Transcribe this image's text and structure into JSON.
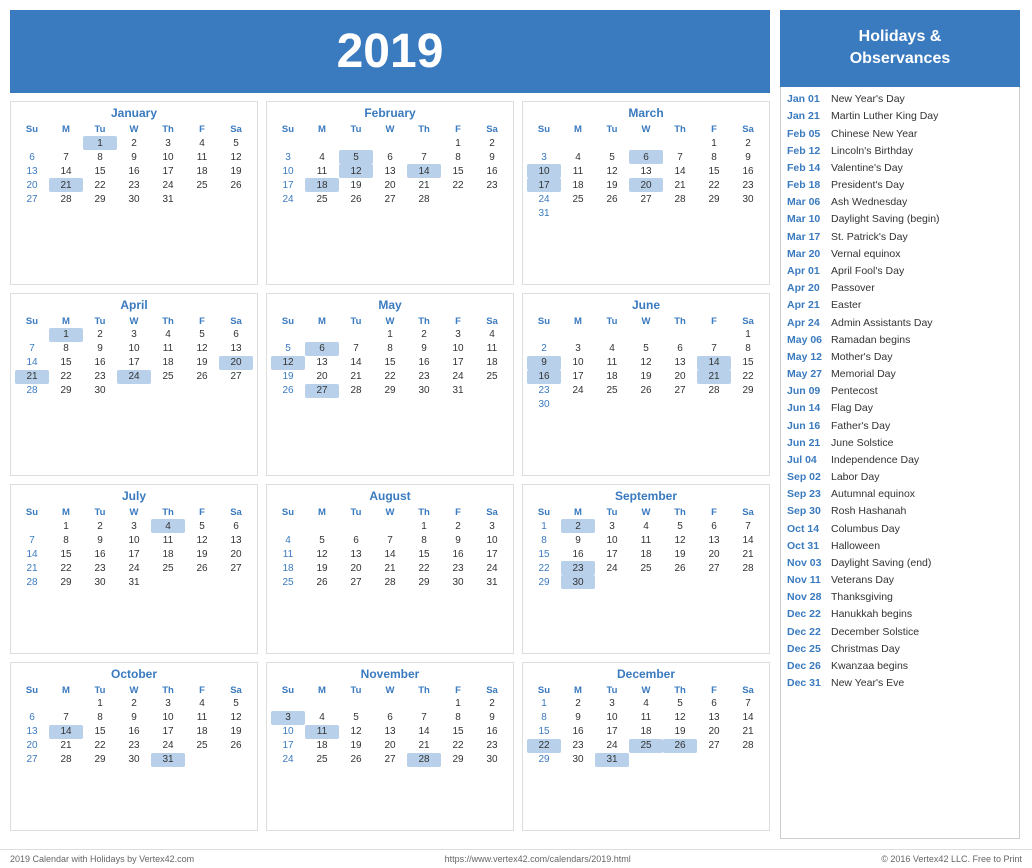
{
  "header": {
    "year": "2019"
  },
  "holidays_header": "Holidays &\nObservances",
  "holidays": [
    {
      "date": "Jan 01",
      "name": "New Year's Day"
    },
    {
      "date": "Jan 21",
      "name": "Martin Luther King Day"
    },
    {
      "date": "Feb 05",
      "name": "Chinese New Year"
    },
    {
      "date": "Feb 12",
      "name": "Lincoln's Birthday"
    },
    {
      "date": "Feb 14",
      "name": "Valentine's Day"
    },
    {
      "date": "Feb 18",
      "name": "President's Day"
    },
    {
      "date": "Mar 06",
      "name": "Ash Wednesday"
    },
    {
      "date": "Mar 10",
      "name": "Daylight Saving (begin)"
    },
    {
      "date": "Mar 17",
      "name": "St. Patrick's Day"
    },
    {
      "date": "Mar 20",
      "name": "Vernal equinox"
    },
    {
      "date": "Apr 01",
      "name": "April Fool's Day"
    },
    {
      "date": "Apr 20",
      "name": "Passover"
    },
    {
      "date": "Apr 21",
      "name": "Easter"
    },
    {
      "date": "Apr 24",
      "name": "Admin Assistants Day"
    },
    {
      "date": "May 06",
      "name": "Ramadan begins"
    },
    {
      "date": "May 12",
      "name": "Mother's Day"
    },
    {
      "date": "May 27",
      "name": "Memorial Day"
    },
    {
      "date": "Jun 09",
      "name": "Pentecost"
    },
    {
      "date": "Jun 14",
      "name": "Flag Day"
    },
    {
      "date": "Jun 16",
      "name": "Father's Day"
    },
    {
      "date": "Jun 21",
      "name": "June Solstice"
    },
    {
      "date": "Jul 04",
      "name": "Independence Day"
    },
    {
      "date": "Sep 02",
      "name": "Labor Day"
    },
    {
      "date": "Sep 23",
      "name": "Autumnal equinox"
    },
    {
      "date": "Sep 30",
      "name": "Rosh Hashanah"
    },
    {
      "date": "Oct 14",
      "name": "Columbus Day"
    },
    {
      "date": "Oct 31",
      "name": "Halloween"
    },
    {
      "date": "Nov 03",
      "name": "Daylight Saving (end)"
    },
    {
      "date": "Nov 11",
      "name": "Veterans Day"
    },
    {
      "date": "Nov 28",
      "name": "Thanksgiving"
    },
    {
      "date": "Dec 22",
      "name": "Hanukkah begins"
    },
    {
      "date": "Dec 22",
      "name": "December Solstice"
    },
    {
      "date": "Dec 25",
      "name": "Christmas Day"
    },
    {
      "date": "Dec 26",
      "name": "Kwanzaa begins"
    },
    {
      "date": "Dec 31",
      "name": "New Year's Eve"
    }
  ],
  "footer": {
    "left": "2019 Calendar with Holidays by Vertex42.com",
    "center": "https://www.vertex42.com/calendars/2019.html",
    "right": "© 2016 Vertex42 LLC. Free to Print"
  },
  "months": [
    {
      "name": "January",
      "days": [
        [
          null,
          null,
          1,
          2,
          3,
          4,
          5
        ],
        [
          6,
          7,
          8,
          9,
          10,
          11,
          12
        ],
        [
          13,
          14,
          15,
          16,
          17,
          18,
          19
        ],
        [
          20,
          21,
          22,
          23,
          24,
          25,
          26
        ],
        [
          27,
          28,
          29,
          30,
          31,
          null,
          null
        ]
      ],
      "highlights": [
        1,
        21
      ],
      "sunday_col_highlights": [
        6,
        13,
        20,
        27
      ]
    },
    {
      "name": "February",
      "days": [
        [
          null,
          null,
          null,
          null,
          null,
          1,
          2
        ],
        [
          3,
          4,
          5,
          6,
          7,
          8,
          9
        ],
        [
          10,
          11,
          12,
          13,
          14,
          15,
          16
        ],
        [
          17,
          18,
          19,
          20,
          21,
          22,
          23
        ],
        [
          24,
          25,
          26,
          27,
          28,
          null,
          null
        ]
      ],
      "highlights": [
        5,
        12,
        14,
        18
      ],
      "sunday_col_highlights": [
        3,
        10,
        17,
        24
      ]
    },
    {
      "name": "March",
      "days": [
        [
          null,
          null,
          null,
          null,
          null,
          1,
          2
        ],
        [
          3,
          4,
          5,
          6,
          7,
          8,
          9
        ],
        [
          10,
          11,
          12,
          13,
          14,
          15,
          16
        ],
        [
          17,
          18,
          19,
          20,
          21,
          22,
          23
        ],
        [
          24,
          25,
          26,
          27,
          28,
          29,
          30
        ],
        [
          31,
          null,
          null,
          null,
          null,
          null,
          null
        ]
      ],
      "highlights": [
        6,
        10,
        17,
        20
      ],
      "sunday_col_highlights": [
        3,
        10,
        17,
        24,
        31
      ]
    },
    {
      "name": "April",
      "days": [
        [
          null,
          1,
          2,
          3,
          4,
          5,
          6
        ],
        [
          7,
          8,
          9,
          10,
          11,
          12,
          13
        ],
        [
          14,
          15,
          16,
          17,
          18,
          19,
          20
        ],
        [
          21,
          22,
          23,
          24,
          25,
          26,
          27
        ],
        [
          28,
          29,
          30,
          null,
          null,
          null,
          null
        ]
      ],
      "highlights": [
        1,
        20,
        21,
        24
      ],
      "sunday_col_highlights": [
        7,
        14,
        21,
        28
      ]
    },
    {
      "name": "May",
      "days": [
        [
          null,
          null,
          null,
          1,
          2,
          3,
          4
        ],
        [
          5,
          6,
          7,
          8,
          9,
          10,
          11
        ],
        [
          12,
          13,
          14,
          15,
          16,
          17,
          18
        ],
        [
          19,
          20,
          21,
          22,
          23,
          24,
          25
        ],
        [
          26,
          27,
          28,
          29,
          30,
          31,
          null
        ]
      ],
      "highlights": [
        6,
        12,
        27
      ],
      "sunday_col_highlights": [
        5,
        12,
        19,
        26
      ]
    },
    {
      "name": "June",
      "days": [
        [
          null,
          null,
          null,
          null,
          null,
          null,
          1
        ],
        [
          2,
          3,
          4,
          5,
          6,
          7,
          8
        ],
        [
          9,
          10,
          11,
          12,
          13,
          14,
          15
        ],
        [
          16,
          17,
          18,
          19,
          20,
          21,
          22
        ],
        [
          23,
          24,
          25,
          26,
          27,
          28,
          29
        ],
        [
          30,
          null,
          null,
          null,
          null,
          null,
          null
        ]
      ],
      "highlights": [
        9,
        14,
        16,
        21
      ],
      "sunday_col_highlights": [
        2,
        9,
        16,
        23,
        30
      ]
    },
    {
      "name": "July",
      "days": [
        [
          null,
          1,
          2,
          3,
          4,
          5,
          6
        ],
        [
          7,
          8,
          9,
          10,
          11,
          12,
          13
        ],
        [
          14,
          15,
          16,
          17,
          18,
          19,
          20
        ],
        [
          21,
          22,
          23,
          24,
          25,
          26,
          27
        ],
        [
          28,
          29,
          30,
          31,
          null,
          null,
          null
        ]
      ],
      "highlights": [
        4
      ],
      "sunday_col_highlights": [
        7,
        14,
        21,
        28
      ]
    },
    {
      "name": "August",
      "days": [
        [
          null,
          null,
          null,
          null,
          1,
          2,
          3
        ],
        [
          4,
          5,
          6,
          7,
          8,
          9,
          10
        ],
        [
          11,
          12,
          13,
          14,
          15,
          16,
          17
        ],
        [
          18,
          19,
          20,
          21,
          22,
          23,
          24
        ],
        [
          25,
          26,
          27,
          28,
          29,
          30,
          31
        ]
      ],
      "highlights": [],
      "sunday_col_highlights": [
        4,
        11,
        18,
        25
      ]
    },
    {
      "name": "September",
      "days": [
        [
          1,
          2,
          3,
          4,
          5,
          6,
          7
        ],
        [
          8,
          9,
          10,
          11,
          12,
          13,
          14
        ],
        [
          15,
          16,
          17,
          18,
          19,
          20,
          21
        ],
        [
          22,
          23,
          24,
          25,
          26,
          27,
          28
        ],
        [
          29,
          30,
          null,
          null,
          null,
          null,
          null
        ]
      ],
      "highlights": [
        2,
        23,
        30
      ],
      "sunday_col_highlights": [
        1,
        8,
        15,
        22,
        29
      ]
    },
    {
      "name": "October",
      "days": [
        [
          null,
          null,
          1,
          2,
          3,
          4,
          5
        ],
        [
          6,
          7,
          8,
          9,
          10,
          11,
          12
        ],
        [
          13,
          14,
          15,
          16,
          17,
          18,
          19
        ],
        [
          20,
          21,
          22,
          23,
          24,
          25,
          26
        ],
        [
          27,
          28,
          29,
          30,
          31,
          null,
          null
        ]
      ],
      "highlights": [
        14,
        31
      ],
      "sunday_col_highlights": [
        6,
        13,
        20,
        27
      ]
    },
    {
      "name": "November",
      "days": [
        [
          null,
          null,
          null,
          null,
          null,
          1,
          2
        ],
        [
          3,
          4,
          5,
          6,
          7,
          8,
          9
        ],
        [
          10,
          11,
          12,
          13,
          14,
          15,
          16
        ],
        [
          17,
          18,
          19,
          20,
          21,
          22,
          23
        ],
        [
          24,
          25,
          26,
          27,
          28,
          29,
          30
        ]
      ],
      "highlights": [
        3,
        11,
        28
      ],
      "sunday_col_highlights": [
        3,
        10,
        17,
        24
      ]
    },
    {
      "name": "December",
      "days": [
        [
          1,
          2,
          3,
          4,
          5,
          6,
          7
        ],
        [
          8,
          9,
          10,
          11,
          12,
          13,
          14
        ],
        [
          15,
          16,
          17,
          18,
          19,
          20,
          21
        ],
        [
          22,
          23,
          24,
          25,
          26,
          27,
          28
        ],
        [
          29,
          30,
          31,
          null,
          null,
          null,
          null
        ]
      ],
      "highlights": [
        22,
        25,
        26,
        31
      ],
      "sunday_col_highlights": [
        1,
        8,
        15,
        22,
        29
      ]
    }
  ]
}
